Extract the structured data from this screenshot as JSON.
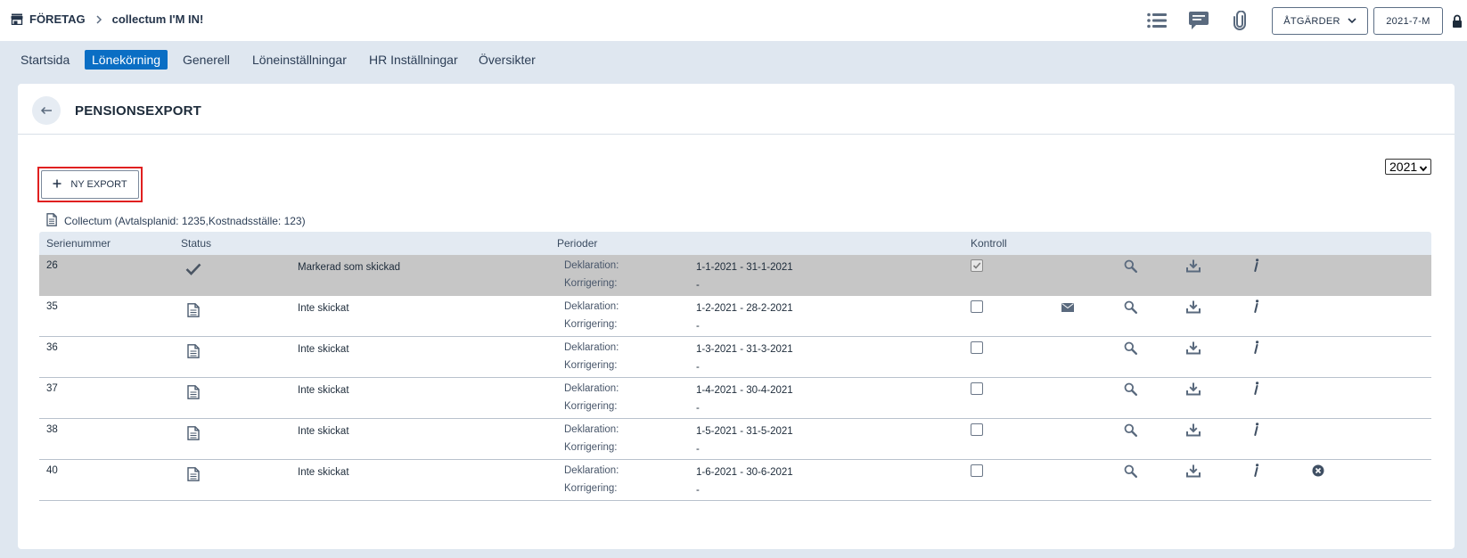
{
  "topbar": {
    "company_label": "FÖRETAG",
    "company_name": "collectum I'M IN!",
    "actions_label": "ÅTGÄRDER",
    "period_label": "2021-7-M",
    "icons": [
      "store-icon",
      "list-icon",
      "chat-icon",
      "paperclip-icon",
      "lock-icon"
    ]
  },
  "nav": {
    "tabs": [
      {
        "label": "Startsida",
        "active": false
      },
      {
        "label": "Lönekörning",
        "active": true
      },
      {
        "label": "Generell",
        "active": false
      },
      {
        "label": "Löneinställningar",
        "active": false
      },
      {
        "label": "HR Inställningar",
        "active": false
      },
      {
        "label": "Översikter",
        "active": false
      }
    ]
  },
  "page": {
    "title": "PENSIONSEXPORT",
    "year": "2021",
    "new_export_label": "NY EXPORT",
    "provider": "Collectum (Avtalsplanid: 1235,Kostnadsställe: 123)"
  },
  "table": {
    "headers": {
      "serial": "Serienummer",
      "status": "Status",
      "periods": "Perioder",
      "control": "Kontroll"
    },
    "declaration_label": "Deklaration:",
    "correction_label": "Korrigering:",
    "rows": [
      {
        "serial": "26",
        "status_icon": "check-icon",
        "status": "Markerad som skickad",
        "declaration": "1-1-2021 - 31-1-2021",
        "correction": "-",
        "control_checked": true,
        "has_email": false,
        "has_delete": false,
        "selected": true
      },
      {
        "serial": "35",
        "status_icon": "document-icon",
        "status": "Inte skickat",
        "declaration": "1-2-2021 - 28-2-2021",
        "correction": "-",
        "control_checked": false,
        "has_email": true,
        "has_delete": false,
        "selected": false
      },
      {
        "serial": "36",
        "status_icon": "document-icon",
        "status": "Inte skickat",
        "declaration": "1-3-2021 - 31-3-2021",
        "correction": "-",
        "control_checked": false,
        "has_email": false,
        "has_delete": false,
        "selected": false
      },
      {
        "serial": "37",
        "status_icon": "document-icon",
        "status": "Inte skickat",
        "declaration": "1-4-2021 - 30-4-2021",
        "correction": "-",
        "control_checked": false,
        "has_email": false,
        "has_delete": false,
        "selected": false
      },
      {
        "serial": "38",
        "status_icon": "document-icon",
        "status": "Inte skickat",
        "declaration": "1-5-2021 - 31-5-2021",
        "correction": "-",
        "control_checked": false,
        "has_email": false,
        "has_delete": false,
        "selected": false
      },
      {
        "serial": "40",
        "status_icon": "document-icon",
        "status": "Inte skickat",
        "declaration": "1-6-2021 - 30-6-2021",
        "correction": "-",
        "control_checked": false,
        "has_email": false,
        "has_delete": true,
        "selected": false
      }
    ]
  },
  "colors": {
    "accent": "#0a6ec4",
    "page_bg": "#dfe7f0",
    "selected_row": "#c6c6c6",
    "highlight_frame": "#e02020"
  }
}
